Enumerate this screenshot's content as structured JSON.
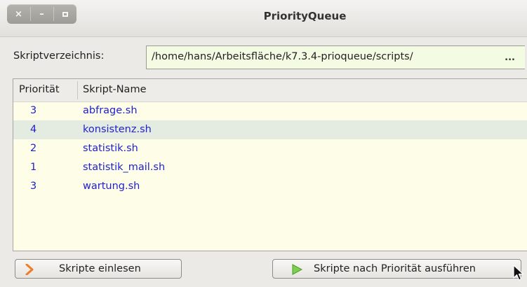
{
  "window": {
    "title": "PriorityQueue"
  },
  "directory": {
    "label": "Skriptverzeichnis:",
    "value": "/home/hans/Arbeitsfläche/k7.3.4-prioqueue/scripts/",
    "browse_label": "..."
  },
  "table": {
    "columns": [
      "Priorität",
      "Skript-Name"
    ],
    "rows": [
      {
        "priority": "3",
        "name": "abfrage.sh",
        "selected": false
      },
      {
        "priority": "4",
        "name": "konsistenz.sh",
        "selected": true
      },
      {
        "priority": "2",
        "name": "statistik.sh",
        "selected": false
      },
      {
        "priority": "1",
        "name": "statistik_mail.sh",
        "selected": false
      },
      {
        "priority": "3",
        "name": "wartung.sh",
        "selected": false
      }
    ]
  },
  "buttons": {
    "read_label": "Skripte einlesen",
    "run_label": "Skripte nach Priorität ausführen"
  },
  "icons": {
    "close": "close-icon",
    "minimize": "minimize-icon",
    "maximize": "maximize-icon",
    "read": "chevron-right-icon",
    "run": "play-icon",
    "cursor": "mouse-pointer-icon"
  },
  "colors": {
    "script_text": "#2121cf",
    "path_field_bg": "#f3fbe2",
    "table_bg": "#fefde7",
    "selected_row_bg": "#e4ebe0",
    "read_icon": "#f07b28",
    "run_icon": "#63c13a"
  }
}
